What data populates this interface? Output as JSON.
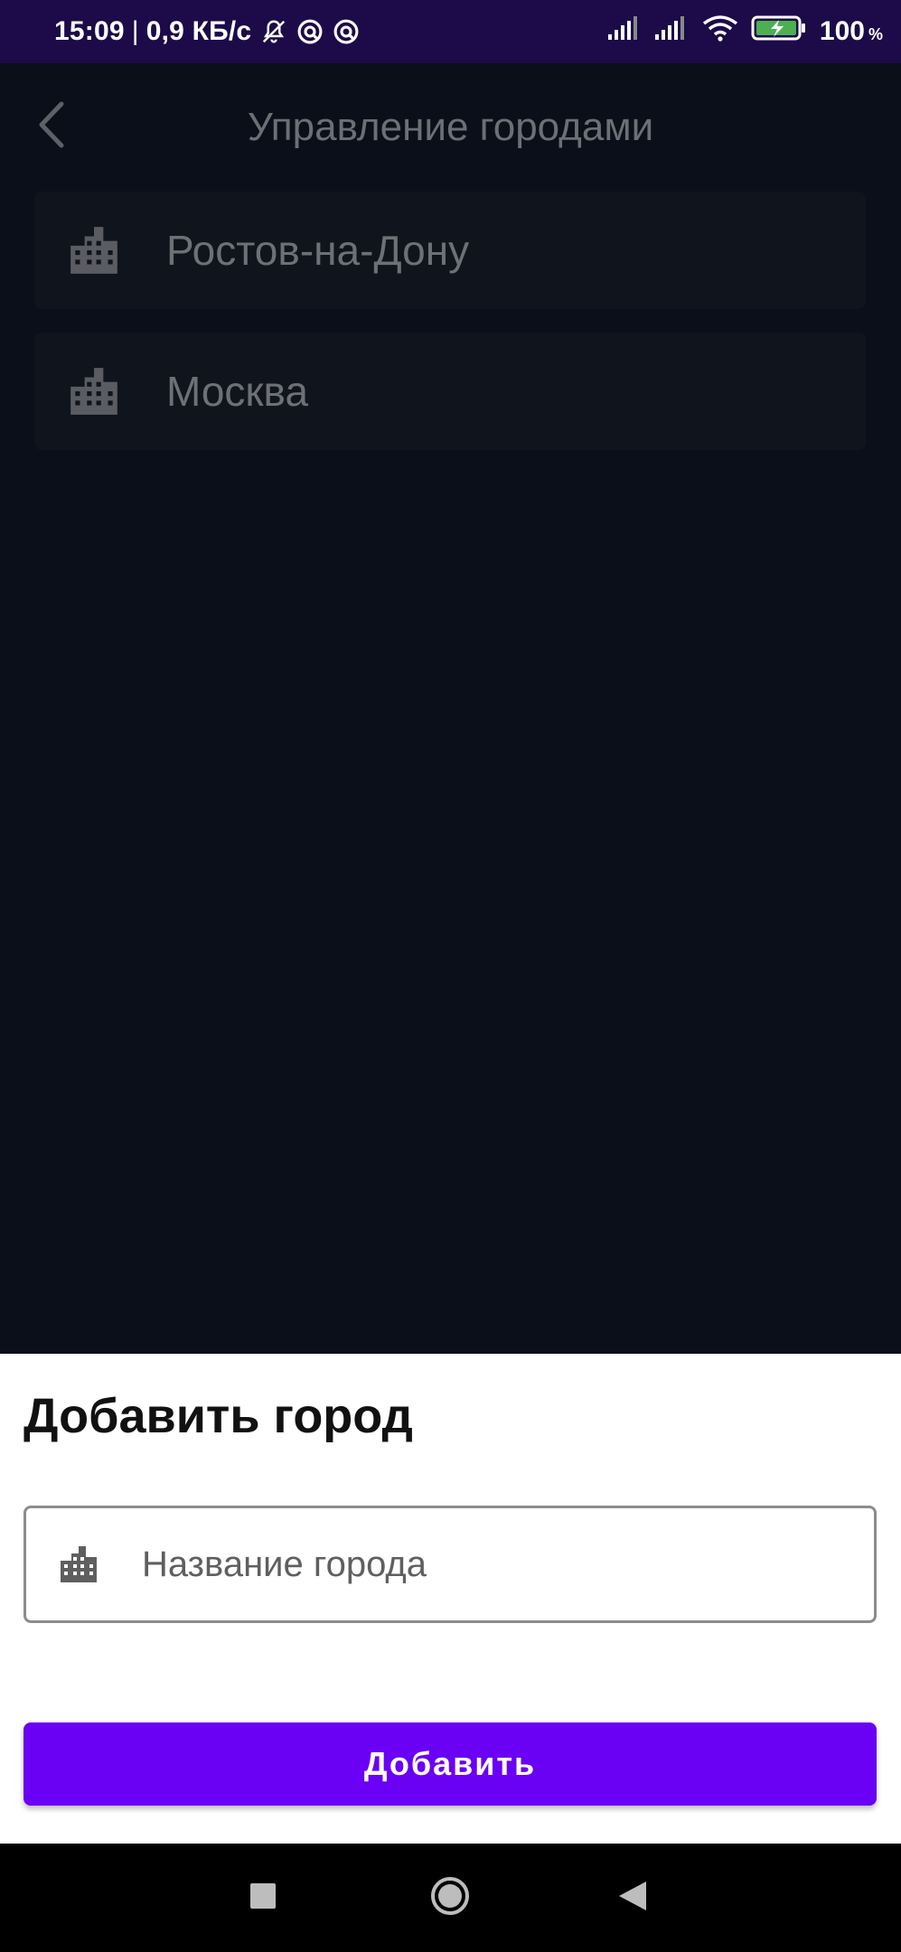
{
  "status_bar": {
    "time": "15:09",
    "separator": "|",
    "network_speed": "0,9 КБ/с",
    "battery_level": "100",
    "battery_unit": "%",
    "icons": [
      "bell-off-icon",
      "vpn-icon",
      "vpn-icon",
      "signal-icon",
      "signal-icon",
      "wifi-icon",
      "battery-charging-icon"
    ],
    "background": "#1c0a49"
  },
  "header": {
    "back_icon": "chevron-left-icon",
    "title": "Управление городами"
  },
  "cities": [
    {
      "name": "Ростов-на-Дону",
      "icon": "building-icon"
    },
    {
      "name": "Москва",
      "icon": "building-icon"
    }
  ],
  "sheet": {
    "title": "Добавить город",
    "input": {
      "placeholder": "Название города",
      "value": "",
      "icon": "building-icon"
    },
    "button_label": "Добавить"
  },
  "nav_bar": {
    "buttons": [
      "recents-icon",
      "home-icon",
      "back-icon"
    ]
  },
  "colors": {
    "accent": "#6a00f4",
    "app_background": "#0a0f19",
    "card_background": "#0f141d",
    "sheet_background": "#ffffff"
  }
}
